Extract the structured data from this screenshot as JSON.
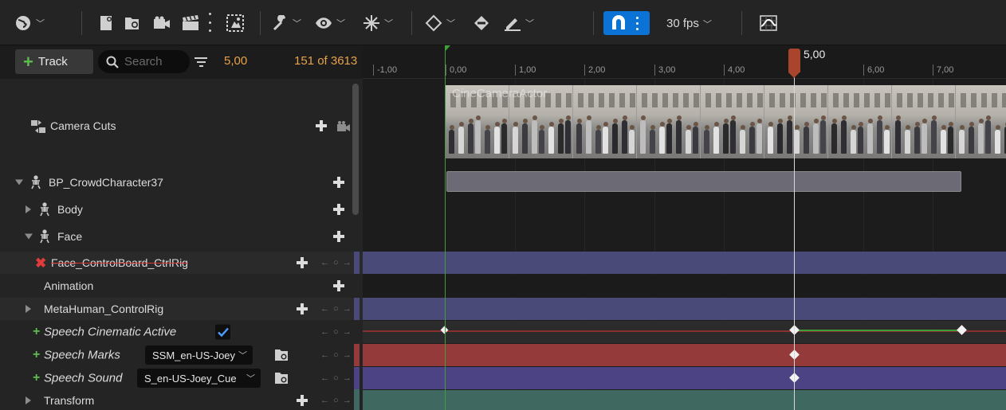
{
  "toolbar": {
    "fps_label": "30 fps",
    "icons": [
      "world-icon",
      "settings-icon",
      "browse-icon",
      "camera-icon",
      "clapper-icon",
      "render-icon",
      "wrench-icon",
      "eye-icon",
      "transform-icon",
      "keyframe-icon",
      "auto-key-icon",
      "edit-icon",
      "magnet-icon",
      "curve-editor-icon"
    ]
  },
  "filter_bar": {
    "track_button": "Track",
    "search_placeholder": "Search",
    "current_time": "5,00",
    "item_count": "151 of 3613"
  },
  "tracks": {
    "camera_cuts": "Camera Cuts",
    "crowd_character": "BP_CrowdCharacter37",
    "body": "Body",
    "face": "Face",
    "face_control_board": "Face_ControlBoard_CtrlRig",
    "animation": "Animation",
    "metahuman_control_rig": "MetaHuman_ControlRig",
    "speech_active": "Speech Cinematic Active",
    "speech_marks": "Speech Marks",
    "speech_marks_value": "SSM_en-US-Joey",
    "speech_sound": "Speech Sound",
    "speech_sound_value": "S_en-US-Joey_Cue",
    "transform": "Transform",
    "keynav": "← ○ →"
  },
  "timeline": {
    "ticks": [
      "-1,00",
      "0,00",
      "1,00",
      "2,00",
      "3,00",
      "4,00",
      "6,00",
      "7,00"
    ],
    "playhead_label": "5,00",
    "camera_actor_label": "CineCameraActor",
    "colors": {
      "playhead": "#a9442d",
      "start_marker": "#3f9d3a",
      "control_rig_lane": "#4a4a78",
      "speech_marks_lane": "#953a3a",
      "speech_sound_lane": "#4c4384",
      "transform_lane": "#3f6860",
      "section_bar": "#6c6a75"
    }
  }
}
